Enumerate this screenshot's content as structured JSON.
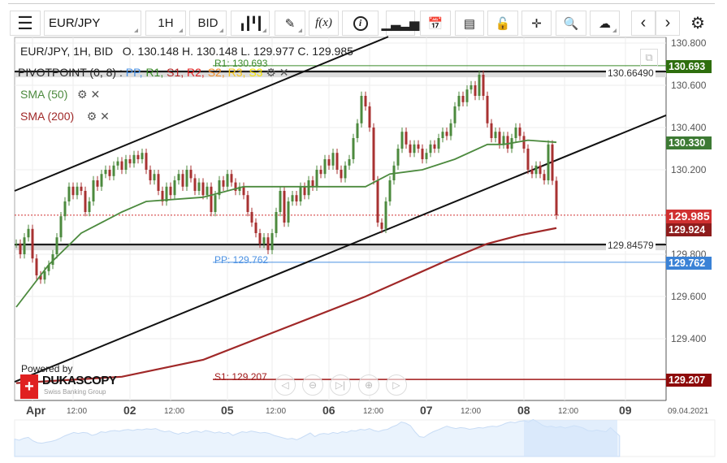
{
  "toolbar": {
    "menu_icon": "hamburger-icon",
    "symbol": "EUR/JPY",
    "timeframe": "1H",
    "side": "BID",
    "chart_type_icon": "candlestick-icon",
    "draw_icon": "pencil-icon",
    "fx_label": "f(x)",
    "info_label": "i",
    "icons": [
      "bar-chart-icon",
      "calendar-icon",
      "news-icon",
      "lock-icon",
      "crosshair-icon",
      "zoom-chart-icon",
      "cloud-upload-icon",
      "chevron-left-icon",
      "chevron-right-icon",
      "gear-icon"
    ]
  },
  "header": {
    "instrument": "EUR/JPY, 1H, BID",
    "ohlc": "O. 130.148 H. 130.148 L. 129.977 C. 129.985"
  },
  "indicators": {
    "pivot": {
      "name": "PIVOTPOINT (0, 8)",
      "sep": " : ",
      "items": [
        {
          "label": "PP",
          "color": "#4a90e2"
        },
        {
          "label": "R1",
          "color": "#3a8a2a"
        },
        {
          "label": "S1",
          "color": "#b22222"
        },
        {
          "label": "R2",
          "color": "#e02020"
        },
        {
          "label": "S2",
          "color": "#f08a24"
        },
        {
          "label": "R3",
          "color": "#f5c518"
        },
        {
          "label": "S3",
          "color": "#f5e400"
        }
      ]
    },
    "sma50": {
      "label": "SMA (50)",
      "color": "#4c8a3e"
    },
    "sma200": {
      "label": "SMA (200)",
      "color": "#a02828"
    }
  },
  "chart_data": {
    "type": "candlestick",
    "ylim": [
      129.13,
      130.84
    ],
    "y_ticks": [
      "130.800",
      "130.600",
      "130.400",
      "130.200",
      "129.800",
      "129.600",
      "129.400"
    ],
    "y_tick_values": [
      130.8,
      130.6,
      130.4,
      130.2,
      129.8,
      129.6,
      129.4
    ],
    "x_ticks": [
      {
        "label": "Apr",
        "bar": 4,
        "major": true
      },
      {
        "label": "12:00",
        "bar": 14,
        "major": false
      },
      {
        "label": "02",
        "bar": 28,
        "major": true
      },
      {
        "label": "12:00",
        "bar": 38,
        "major": false
      },
      {
        "label": "05",
        "bar": 52,
        "major": true
      },
      {
        "label": "12:00",
        "bar": 63,
        "major": false
      },
      {
        "label": "06",
        "bar": 77,
        "major": true
      },
      {
        "label": "12:00",
        "bar": 87,
        "major": false
      },
      {
        "label": "07",
        "bar": 101,
        "major": true
      },
      {
        "label": "12:00",
        "bar": 111,
        "major": false
      },
      {
        "label": "08",
        "bar": 125,
        "major": true
      },
      {
        "label": "12:00",
        "bar": 135,
        "major": false
      },
      {
        "label": "09",
        "bar": 150,
        "major": true
      },
      {
        "label": "09.04.2021",
        "bar": 162,
        "major": false
      }
    ],
    "closes": [
      129.85,
      129.8,
      129.88,
      129.92,
      129.78,
      129.7,
      129.68,
      129.72,
      129.75,
      129.8,
      129.88,
      129.98,
      130.05,
      130.12,
      130.08,
      130.12,
      130.1,
      130.0,
      130.05,
      130.15,
      130.12,
      130.18,
      130.2,
      130.17,
      130.22,
      130.24,
      130.2,
      130.25,
      130.23,
      130.27,
      130.25,
      130.28,
      130.2,
      130.15,
      130.18,
      130.1,
      130.05,
      130.12,
      130.08,
      130.15,
      130.18,
      130.12,
      130.2,
      130.16,
      130.1,
      130.14,
      130.08,
      130.12,
      130.0,
      130.08,
      130.15,
      130.12,
      130.18,
      130.14,
      130.1,
      130.12,
      130.08,
      130.0,
      129.95,
      129.9,
      129.85,
      129.88,
      129.82,
      129.9,
      130.0,
      130.1,
      129.95,
      130.05,
      130.08,
      130.05,
      130.12,
      130.08,
      130.15,
      130.12,
      130.2,
      130.18,
      130.25,
      130.22,
      130.28,
      130.2,
      130.16,
      130.22,
      130.25,
      130.35,
      130.42,
      130.55,
      130.5,
      130.4,
      130.15,
      129.95,
      129.92,
      130.05,
      130.15,
      130.22,
      130.3,
      130.38,
      130.32,
      130.28,
      130.32,
      130.3,
      130.25,
      130.28,
      130.32,
      130.3,
      130.35,
      130.38,
      130.36,
      130.42,
      130.5,
      130.55,
      130.52,
      130.58,
      130.6,
      130.55,
      130.65,
      130.55,
      130.42,
      130.35,
      130.38,
      130.32,
      130.36,
      130.3,
      130.35,
      130.4,
      130.36,
      130.3,
      130.2,
      130.18,
      130.22,
      130.18,
      130.15,
      130.32,
      130.148,
      129.985
    ],
    "sma50": [
      [
        0,
        129.55
      ],
      [
        8,
        129.75
      ],
      [
        16,
        129.9
      ],
      [
        26,
        130.0
      ],
      [
        32,
        130.05
      ],
      [
        46,
        130.07
      ],
      [
        56,
        130.12
      ],
      [
        76,
        130.12
      ],
      [
        86,
        130.12
      ],
      [
        92,
        130.18
      ],
      [
        100,
        130.2
      ],
      [
        108,
        130.25
      ],
      [
        116,
        130.32
      ],
      [
        120,
        130.32
      ],
      [
        126,
        130.34
      ],
      [
        133,
        130.33
      ]
    ],
    "sma200": [
      [
        0,
        129.19
      ],
      [
        26,
        129.22
      ],
      [
        46,
        129.3
      ],
      [
        66,
        129.45
      ],
      [
        86,
        129.6
      ],
      [
        106,
        129.77
      ],
      [
        116,
        129.85
      ],
      [
        124,
        129.89
      ],
      [
        133,
        129.924
      ]
    ],
    "trendlines": [
      [
        [
          -0.4,
          130.1
        ],
        [
          91.6,
          130.83
        ]
      ],
      [
        [
          -0.4,
          129.196
        ],
        [
          160,
          130.458
        ]
      ]
    ],
    "hlines": [
      {
        "value": 130.6649,
        "label": "130.66490"
      },
      {
        "value": 129.84579,
        "label": "129.84579"
      }
    ],
    "pivots": {
      "R1": {
        "label": "R1: 130.693",
        "value": 130.693,
        "tag": "130.693"
      },
      "PP": {
        "label": "PP: 129.762",
        "value": 129.762,
        "tag": "129.762"
      },
      "S1": {
        "label": "S1: 129.207",
        "value": 129.207,
        "tag": "129.207"
      }
    },
    "tags": {
      "current": "129.985",
      "sma50": "130.330",
      "sma200": "129.924"
    },
    "colors": {
      "up": "#4c8a3e",
      "down": "#a83232",
      "r1": "#3a8a2a",
      "pp": "#4a90e2",
      "s1": "#a01818",
      "current": "#d03030"
    }
  },
  "branding": {
    "powered_by": "Powered by",
    "logo": "DUKASCOPY",
    "tagline": "Swiss Banking Group"
  },
  "nav_buttons": [
    "scroll-left",
    "zoom-out",
    "reset",
    "zoom-in",
    "scroll-right"
  ]
}
